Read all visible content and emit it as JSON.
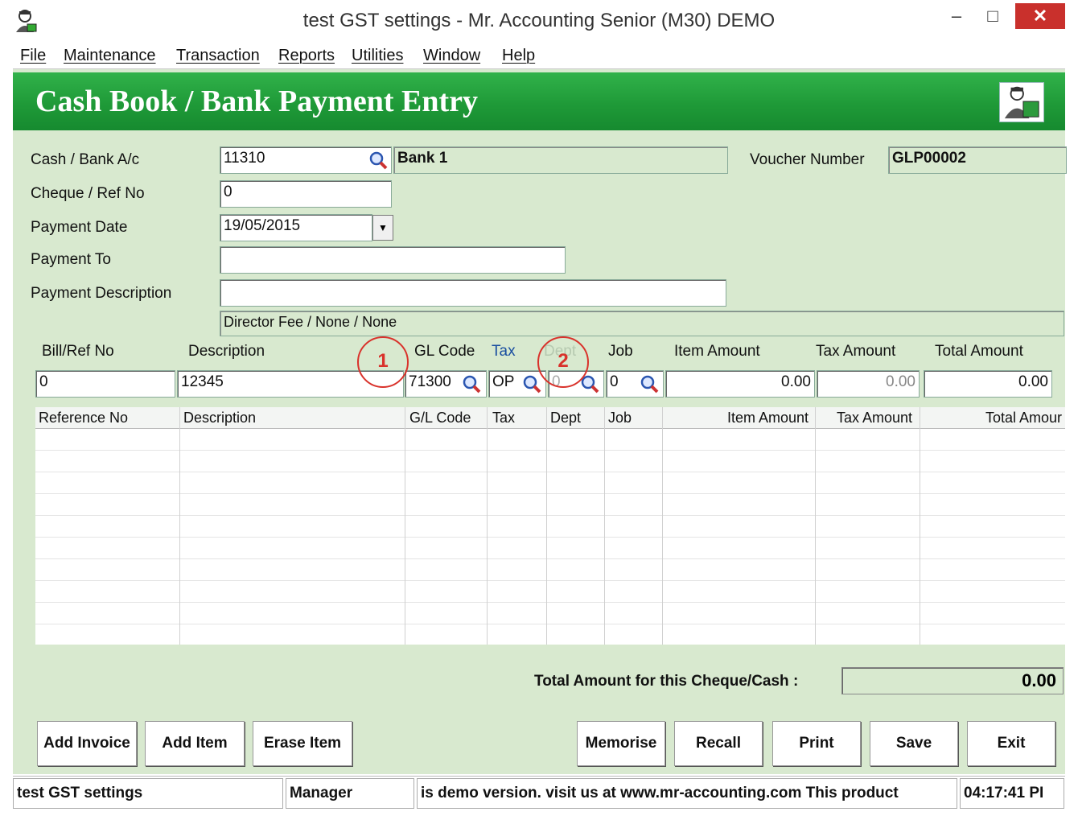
{
  "window": {
    "title": "test GST settings - Mr. Accounting Senior (M30) DEMO",
    "minimize_glyph": "–",
    "maximize_glyph": "□",
    "close_glyph": "✕"
  },
  "menu": [
    "File",
    "Maintenance",
    "Transaction",
    "Reports",
    "Utilities",
    "Window",
    "Help"
  ],
  "header": {
    "title": "Cash Book / Bank Payment Entry"
  },
  "form": {
    "cash_bank_label": "Cash / Bank A/c",
    "cash_bank_value": "11310",
    "cash_bank_name": "Bank 1",
    "voucher_label": "Voucher Number",
    "voucher_value": "GLP00002",
    "cheque_label": "Cheque / Ref No",
    "cheque_value": "0",
    "date_label": "Payment Date",
    "date_value": "19/05/2015",
    "payto_label": "Payment To",
    "payto_value": "",
    "desc_label": "Payment Description",
    "desc_value": "",
    "analysis_value": "Director Fee / None / None"
  },
  "entry": {
    "headers": {
      "bill": "Bill/Ref No",
      "description": "Description",
      "gl_code": "GL Code",
      "tax": "Tax",
      "dept": "Dept",
      "job": "Job",
      "item_amount": "Item Amount",
      "tax_amount": "Tax Amount",
      "total_amount": "Total Amount"
    },
    "values": {
      "bill": "0",
      "description": "12345",
      "gl_code": "71300",
      "tax": "OP",
      "dept": "0",
      "job": "0",
      "item_amount": "0.00",
      "tax_amount": "0.00",
      "total_amount": "0.00"
    },
    "markers": [
      "1",
      "2"
    ]
  },
  "grid": {
    "columns": [
      "Reference No",
      "Description",
      "G/L Code",
      "Tax",
      "Dept",
      "Job",
      "Item Amount",
      "Tax Amount",
      "Total Amour"
    ]
  },
  "totals": {
    "label": "Total Amount for this  Cheque/Cash :",
    "value": "0.00"
  },
  "buttons": {
    "add_invoice": "Add Invoice",
    "add_item": "Add Item",
    "erase_item": "Erase Item",
    "memorise": "Memorise",
    "recall": "Recall",
    "print": "Print",
    "save": "Save",
    "exit": "Exit"
  },
  "status": {
    "company": "test GST settings",
    "user": "Manager",
    "message": "is demo version.  visit us at www.mr-accounting.com This product",
    "time": "04:17:41 PI"
  },
  "colors": {
    "header_green": "#1f9a38",
    "client_bg": "#d8e9cf",
    "marker_red": "#d9322b"
  },
  "icons": [
    "app-icon",
    "search-icon",
    "dropdown-arrow-icon",
    "header-logo-icon"
  ]
}
